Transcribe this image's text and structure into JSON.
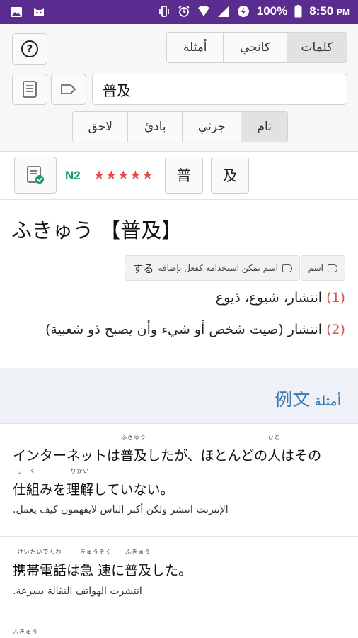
{
  "status_bar": {
    "battery": "100%",
    "time": "8:50",
    "ampm": "PM"
  },
  "header": {
    "help_label": "?",
    "tabs": [
      {
        "label": "أمثلة",
        "active": false
      },
      {
        "label": "كانجي",
        "active": false
      },
      {
        "label": "كلمات",
        "active": true
      }
    ],
    "search_value": "普及",
    "match_modes": [
      {
        "label": "لاحق",
        "active": false
      },
      {
        "label": "بادئ",
        "active": false
      },
      {
        "label": "جزئي",
        "active": false
      },
      {
        "label": "تام",
        "active": true
      }
    ]
  },
  "kanji_row": {
    "jlpt": "N2",
    "stars": "★★★★★",
    "kanji": [
      "普",
      "及"
    ]
  },
  "entry": {
    "reading": "ふきゅう",
    "headword": "【普及】",
    "tags": [
      {
        "label": "اسم"
      },
      {
        "label": "اسم يمكن استخدامه كفعل بإضافة",
        "suffix": "する"
      }
    ],
    "definitions": [
      {
        "num": "(1)",
        "text": "انتشار، شيوع، ذيوع"
      },
      {
        "num": "(2)",
        "text": "انتشار (صيت شخص أو شيء وأن يصبح ذو شعبية)"
      }
    ]
  },
  "examples": {
    "heading_kanji": "例文",
    "heading_label": "أمثلة",
    "items": [
      {
        "line1": [
          {
            "t": "インターネットは"
          },
          {
            "t": "普及",
            "r": "ふきゅう"
          },
          {
            "t": "したが、ほとんどの"
          },
          {
            "t": "人",
            "r": "ひと"
          },
          {
            "t": "はその"
          }
        ],
        "line2": [
          {
            "t": "仕",
            "r": "し"
          },
          {
            "t": "組",
            "r": "く"
          },
          {
            "t": "みを"
          },
          {
            "t": "理解",
            "r": "りかい"
          },
          {
            "t": "していない。"
          }
        ],
        "translation": "الإنترنت انتشر ولكن أكثر الناس لايفهمون كيف يعمل."
      },
      {
        "line1": [
          {
            "t": "携帯電話",
            "r": "けいたいでんわ"
          },
          {
            "t": "は"
          },
          {
            "t": "急 速",
            "r": "きゅうそく"
          },
          {
            "t": "に"
          },
          {
            "t": "普及",
            "r": "ふきゅう"
          },
          {
            "t": "した。"
          }
        ],
        "translation": "انتشرت الهواتف النقالة بسرعة."
      }
    ],
    "partial_furigana": "ふきゅう"
  }
}
